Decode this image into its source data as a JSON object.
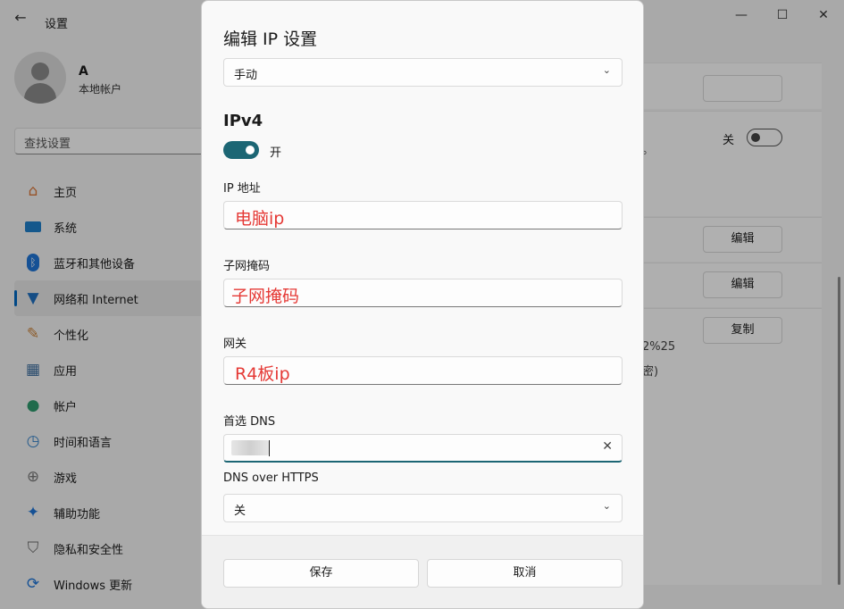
{
  "window": {
    "title": "设置",
    "back_icon": "back-arrow-icon",
    "controls": [
      "minimize-icon",
      "maximize-icon",
      "close-icon"
    ]
  },
  "user": {
    "name": "A",
    "type": "本地帐户"
  },
  "search": {
    "placeholder": "查找设置"
  },
  "sidebar": {
    "items": [
      {
        "label": "主页",
        "icon": "home-icon"
      },
      {
        "label": "系统",
        "icon": "display-icon"
      },
      {
        "label": "蓝牙和其他设备",
        "icon": "bluetooth-icon"
      },
      {
        "label": "网络和 Internet",
        "icon": "wifi-icon",
        "active": true
      },
      {
        "label": "个性化",
        "icon": "brush-icon"
      },
      {
        "label": "应用",
        "icon": "apps-icon"
      },
      {
        "label": "帐户",
        "icon": "account-icon"
      },
      {
        "label": "时间和语言",
        "icon": "clock-globe-icon"
      },
      {
        "label": "游戏",
        "icon": "gamepad-icon"
      },
      {
        "label": "辅助功能",
        "icon": "accessibility-icon"
      },
      {
        "label": "隐私和安全性",
        "icon": "shield-icon"
      },
      {
        "label": "Windows 更新",
        "icon": "update-icon"
      }
    ]
  },
  "content": {
    "off_label": "关",
    "edit_label_1": "编辑",
    "edit_label_2": "编辑",
    "copy_label": "复制",
    "peek_1": "。",
    "peek_2": "2%25",
    "peek_3": "密)"
  },
  "dialog": {
    "title": "编辑 IP 设置",
    "mode_value": "手动",
    "section": "IPv4",
    "ipv4_toggle_label": "开",
    "ip_label": "IP 地址",
    "ip_value": "电脑ip",
    "mask_label": "子网掩码",
    "mask_value": "子网掩码",
    "gateway_label": "网关",
    "gateway_value": "R4板ip",
    "dns_label": "首选 DNS",
    "doh_label": "DNS over HTTPS",
    "doh_value": "关",
    "save_label": "保存",
    "cancel_label": "取消"
  },
  "colors": {
    "accent": "#1c6674",
    "annotation": "#e53935"
  }
}
